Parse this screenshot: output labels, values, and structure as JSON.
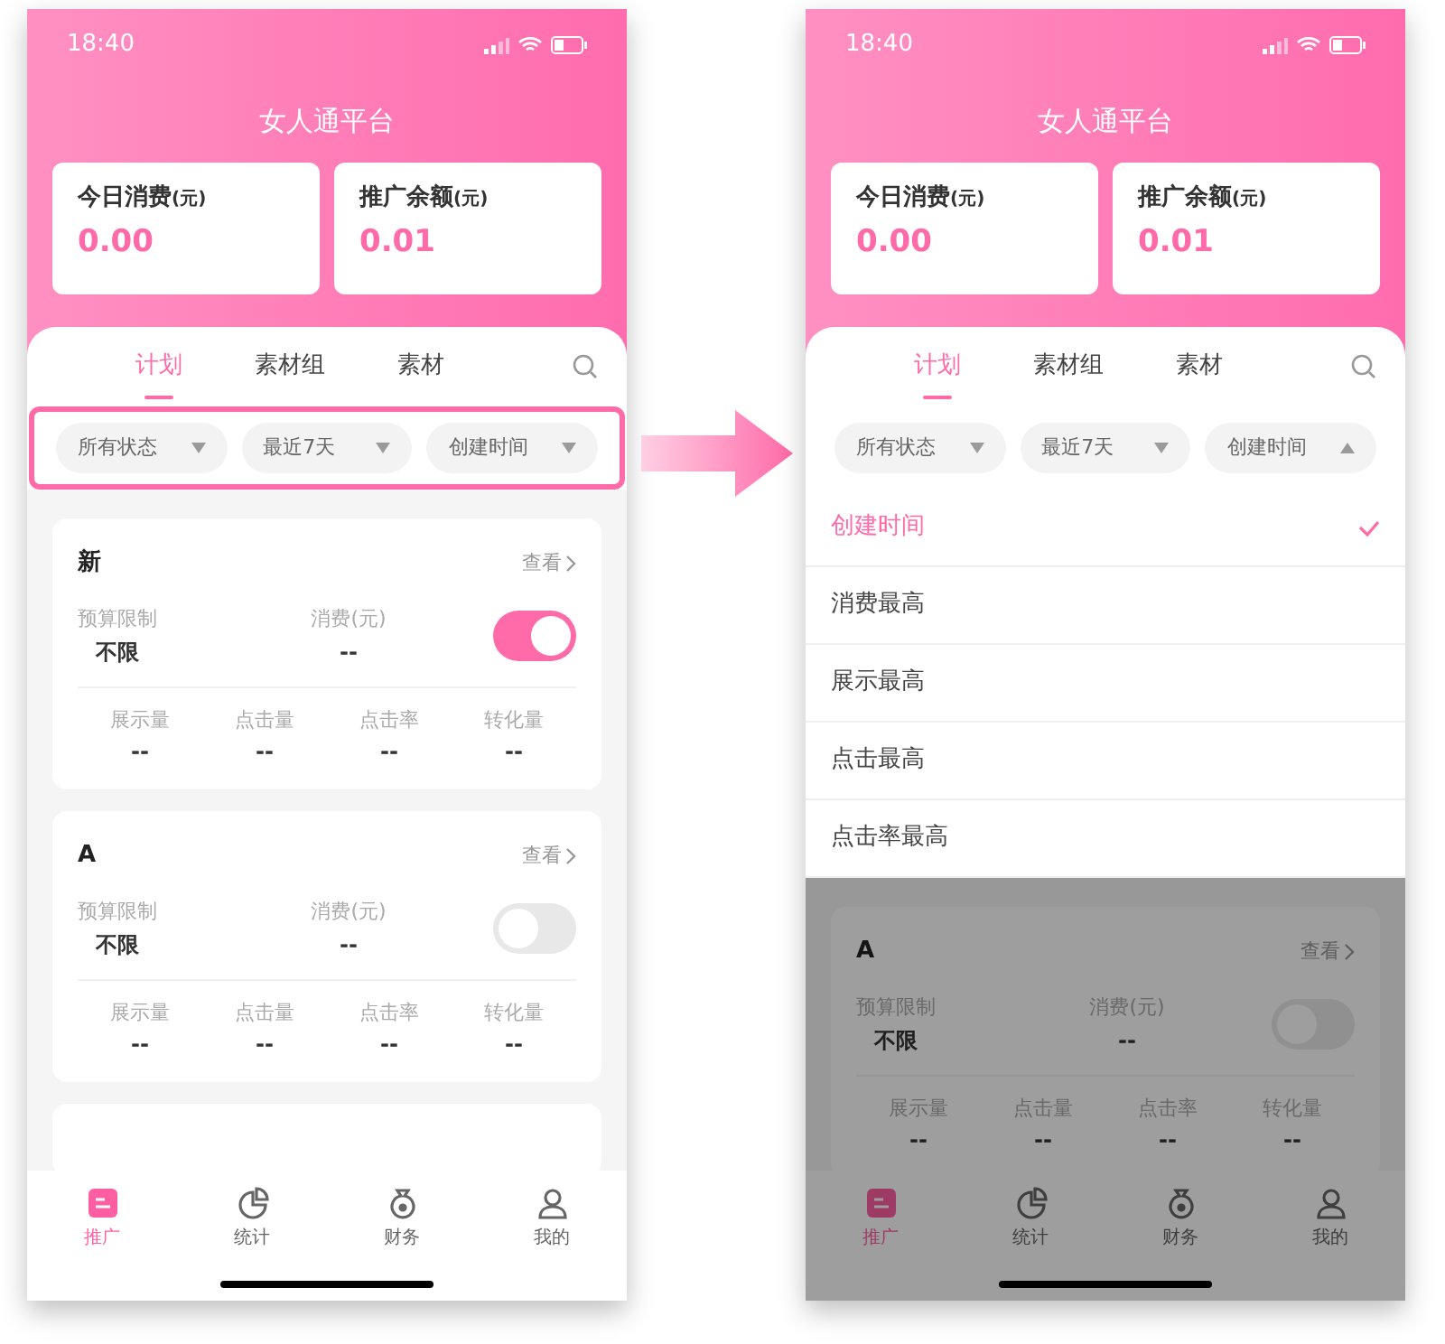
{
  "screens": [
    {
      "status_time": "18:40",
      "title": "女人通平台",
      "stats": [
        {
          "label": "今日消费",
          "unit": "(元)",
          "value": "0.00"
        },
        {
          "label": "推广余额",
          "unit": "(元)",
          "value": "0.01"
        }
      ],
      "tabs": [
        {
          "label": "计划",
          "selected": true
        },
        {
          "label": "素材组",
          "selected": false
        },
        {
          "label": "素材",
          "selected": false
        }
      ],
      "filters_highlighted": true,
      "filters": [
        {
          "label": "所有状态",
          "expanded": false
        },
        {
          "label": "最近7天",
          "expanded": false
        },
        {
          "label": "创建时间",
          "expanded": false
        }
      ],
      "plans": [
        {
          "name": "新",
          "view": "查看",
          "budget_label": "预算限制",
          "budget": "不限",
          "spend_label": "消费(元)",
          "spend": "--",
          "on": true,
          "metrics": [
            {
              "label": "展示量",
              "value": "--"
            },
            {
              "label": "点击量",
              "value": "--"
            },
            {
              "label": "点击率",
              "value": "--"
            },
            {
              "label": "转化量",
              "value": "--"
            }
          ]
        },
        {
          "name": "A",
          "view": "查看",
          "budget_label": "预算限制",
          "budget": "不限",
          "spend_label": "消费(元)",
          "spend": "--",
          "on": false,
          "metrics": [
            {
              "label": "展示量",
              "value": "--"
            },
            {
              "label": "点击量",
              "value": "--"
            },
            {
              "label": "点击率",
              "value": "--"
            },
            {
              "label": "转化量",
              "value": "--"
            }
          ]
        }
      ],
      "dimmed": false,
      "nav": [
        {
          "label": "推广",
          "kind": "promote",
          "selected": true
        },
        {
          "label": "统计",
          "kind": "stats",
          "selected": false
        },
        {
          "label": "财务",
          "kind": "finance",
          "selected": false
        },
        {
          "label": "我的",
          "kind": "mine",
          "selected": false
        }
      ]
    },
    {
      "status_time": "18:40",
      "title": "女人通平台",
      "stats": [
        {
          "label": "今日消费",
          "unit": "(元)",
          "value": "0.00"
        },
        {
          "label": "推广余额",
          "unit": "(元)",
          "value": "0.01"
        }
      ],
      "tabs": [
        {
          "label": "计划",
          "selected": true
        },
        {
          "label": "素材组",
          "selected": false
        },
        {
          "label": "素材",
          "selected": false
        }
      ],
      "filters_highlighted": false,
      "filters": [
        {
          "label": "所有状态",
          "expanded": false
        },
        {
          "label": "最近7天",
          "expanded": false
        },
        {
          "label": "创建时间",
          "expanded": true
        }
      ],
      "sort_menu": [
        {
          "label": "创建时间",
          "selected": true
        },
        {
          "label": "消费最高",
          "selected": false
        },
        {
          "label": "展示最高",
          "selected": false
        },
        {
          "label": "点击最高",
          "selected": false
        },
        {
          "label": "点击率最高",
          "selected": false
        }
      ],
      "plans": [
        {
          "name": "A",
          "view": "查看",
          "budget_label": "预算限制",
          "budget": "不限",
          "spend_label": "消费(元)",
          "spend": "--",
          "on": false,
          "metrics": [
            {
              "label": "展示量",
              "value": "--"
            },
            {
              "label": "点击量",
              "value": "--"
            },
            {
              "label": "点击率",
              "value": "--"
            },
            {
              "label": "转化量",
              "value": "--"
            }
          ]
        }
      ],
      "dimmed": true,
      "nav": [
        {
          "label": "推广",
          "kind": "promote",
          "selected": true
        },
        {
          "label": "统计",
          "kind": "stats",
          "selected": false
        },
        {
          "label": "财务",
          "kind": "finance",
          "selected": false
        },
        {
          "label": "我的",
          "kind": "mine",
          "selected": false
        }
      ]
    }
  ]
}
